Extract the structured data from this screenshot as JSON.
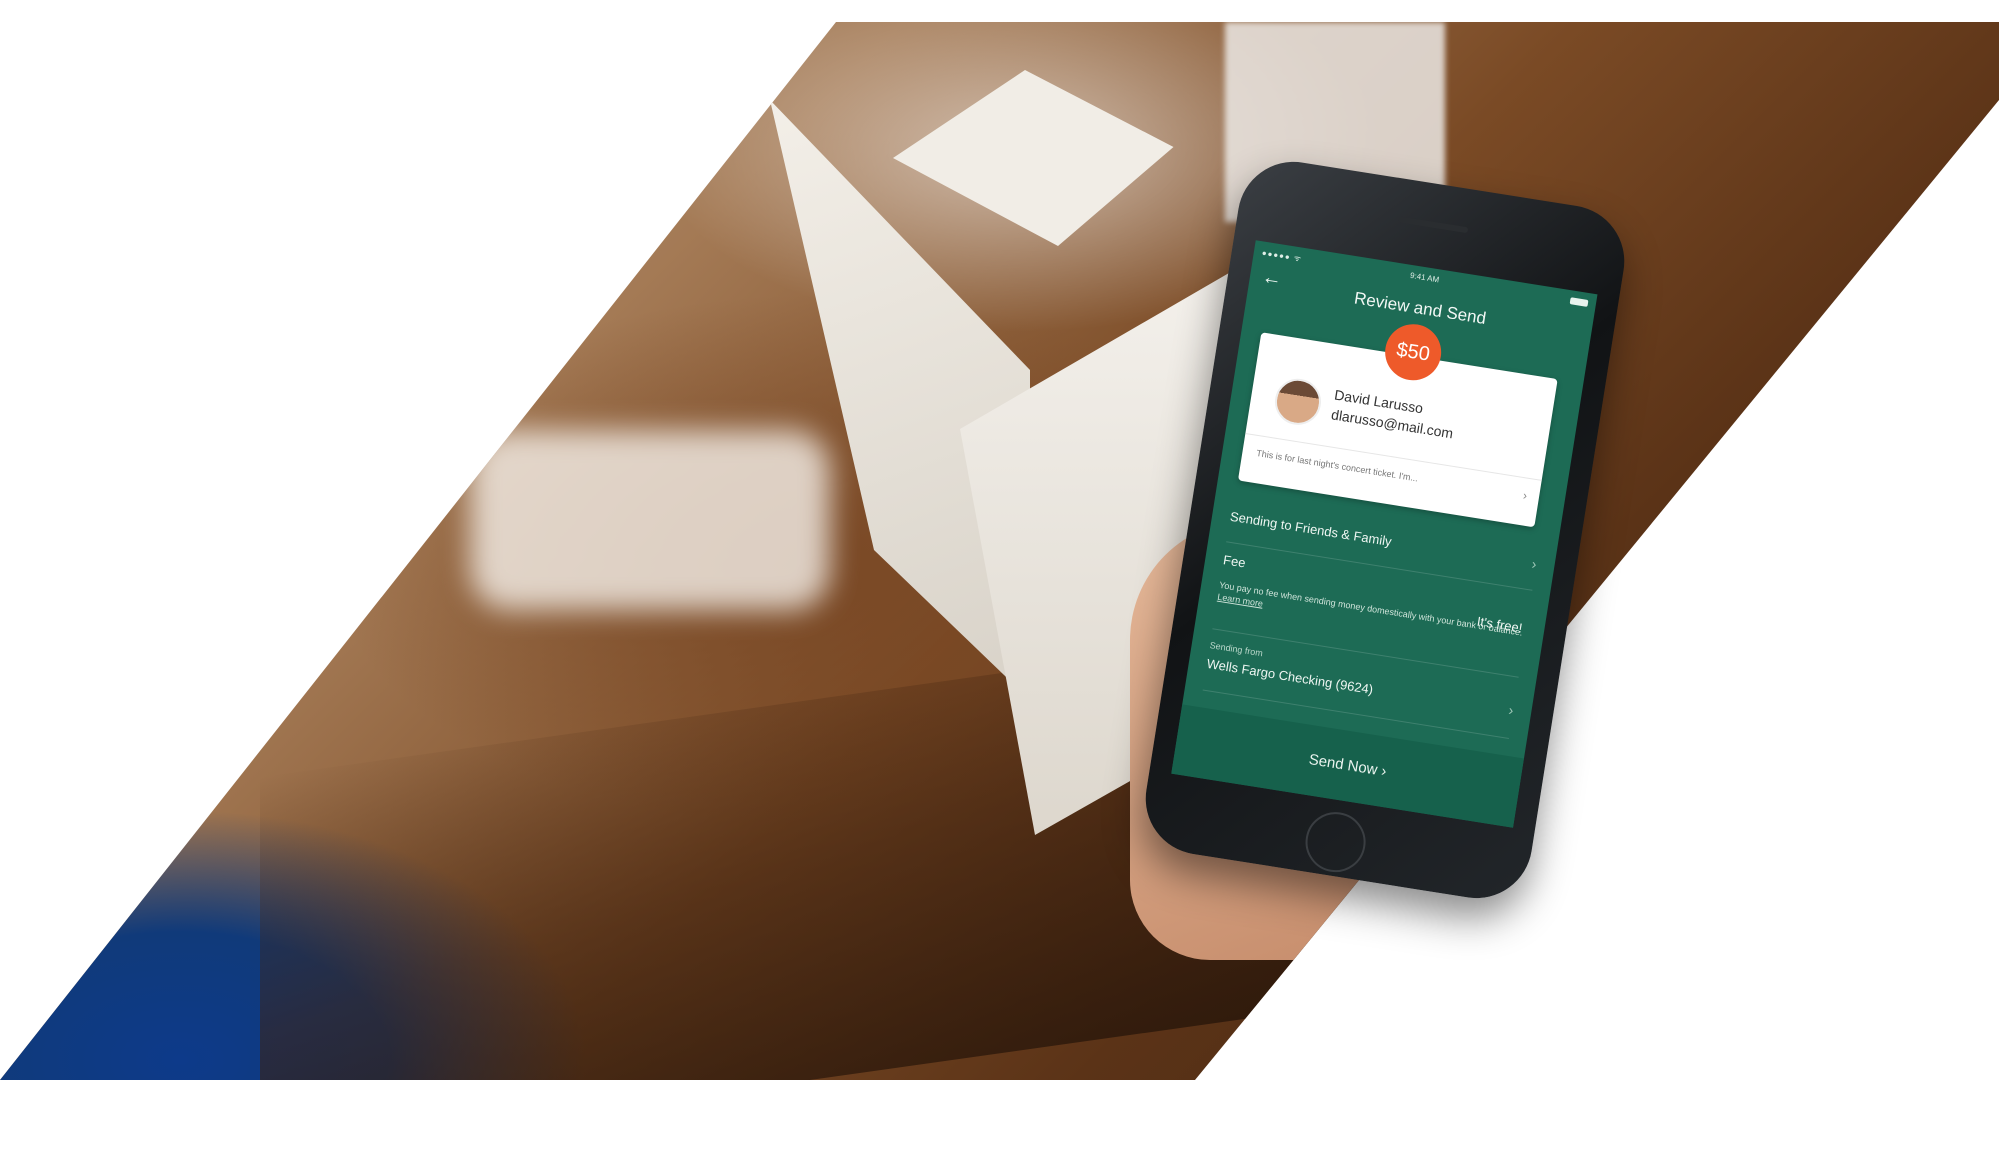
{
  "screen": {
    "status_time": "9:41 AM",
    "status_signal": "●●●●● ᯤ",
    "back_icon": "←",
    "title": "Review and Send",
    "amount": "$50",
    "recipient": {
      "name": "David Larusso",
      "email": "dlarusso@mail.com"
    },
    "note": "This is for last night's concert ticket. I'm...",
    "chevron": "›",
    "sending_to": "Sending to Friends & Family",
    "fee": {
      "label": "Fee",
      "value": "It's free!",
      "description": "You pay no fee when sending money domestically with your bank or balance.",
      "learn_more": "Learn more"
    },
    "sending_from": {
      "label": "Sending from",
      "account": "Wells Fargo Checking (9624)"
    },
    "send_button": "Send Now ›"
  },
  "colors": {
    "screen_green": "#1d6b55",
    "amount_badge": "#ee5a2a",
    "blue_accent": "#0d3a8a"
  }
}
